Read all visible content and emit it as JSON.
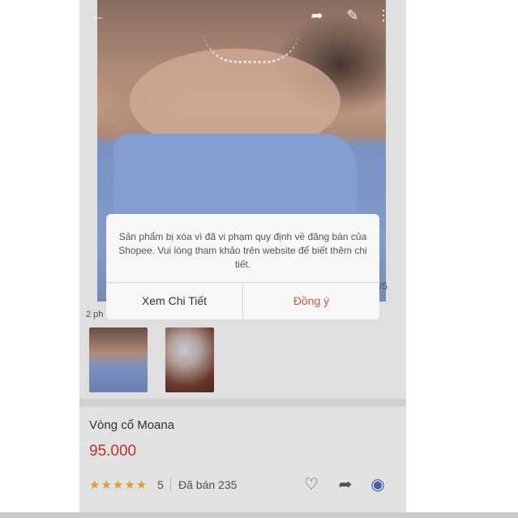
{
  "photo": {
    "counter": "/5"
  },
  "topbar": {
    "back_icon": "arrow-left-icon",
    "share_icon": "share-icon",
    "edit_icon": "edit-icon",
    "more_icon": "more-icon"
  },
  "thumbnails": {
    "label": "2 ph"
  },
  "product": {
    "name": "Vòng cổ Moana",
    "price": "95.000",
    "stars": "★★★★★",
    "rating": "5",
    "sold": "Đã bán 235"
  },
  "actions": {
    "like_icon": "heart-icon",
    "share_icon": "share-icon",
    "chat_icon": "messenger-icon"
  },
  "dialog": {
    "message": "Sản phẩm bị xóa vì đã vi phạm quy định về đăng bán của Shopee. Vui lòng tham khảo trên website để biết thêm chi tiết.",
    "detail_label": "Xem Chi Tiết",
    "ok_label": "Đồng ý"
  },
  "colors": {
    "accent": "#e1573f",
    "price": "#c0392b",
    "star": "#e8a13a",
    "messenger": "#4f63b8"
  }
}
